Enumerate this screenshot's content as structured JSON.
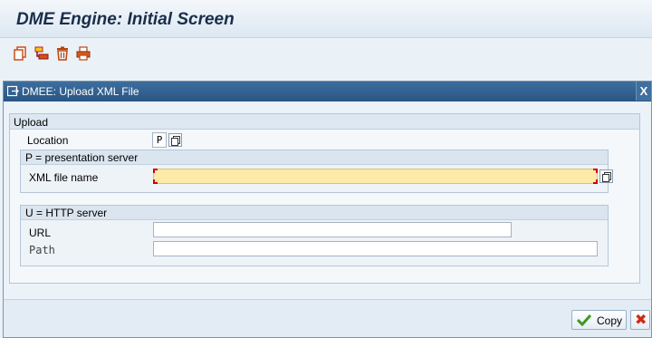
{
  "screen": {
    "title": "DME Engine: Initial Screen"
  },
  "toolbar": {
    "icons": [
      "new-document-icon",
      "transport-icon",
      "delete-icon",
      "print-icon"
    ]
  },
  "dialog": {
    "title": "DMEE: Upload XML File",
    "close_label": "X",
    "upload_section": {
      "header": "Upload",
      "location_label": "Location",
      "location_value": "P",
      "presentation_group": {
        "header": "P = presentation server",
        "xml_file_label": "XML file name",
        "xml_file_value": ""
      },
      "http_group": {
        "header": "U = HTTP server",
        "url_label": "URL",
        "url_value": "",
        "path_label": "Path",
        "path_value": ""
      }
    },
    "buttons": {
      "copy_label": "Copy",
      "cancel_icon": "cancel-icon"
    }
  },
  "colors": {
    "dialog_header": "#2a5584",
    "required_field": "#fde9a8",
    "required_marker": "#d40000",
    "copy_check": "#3c9a1b",
    "cancel_x": "#d12a10"
  }
}
